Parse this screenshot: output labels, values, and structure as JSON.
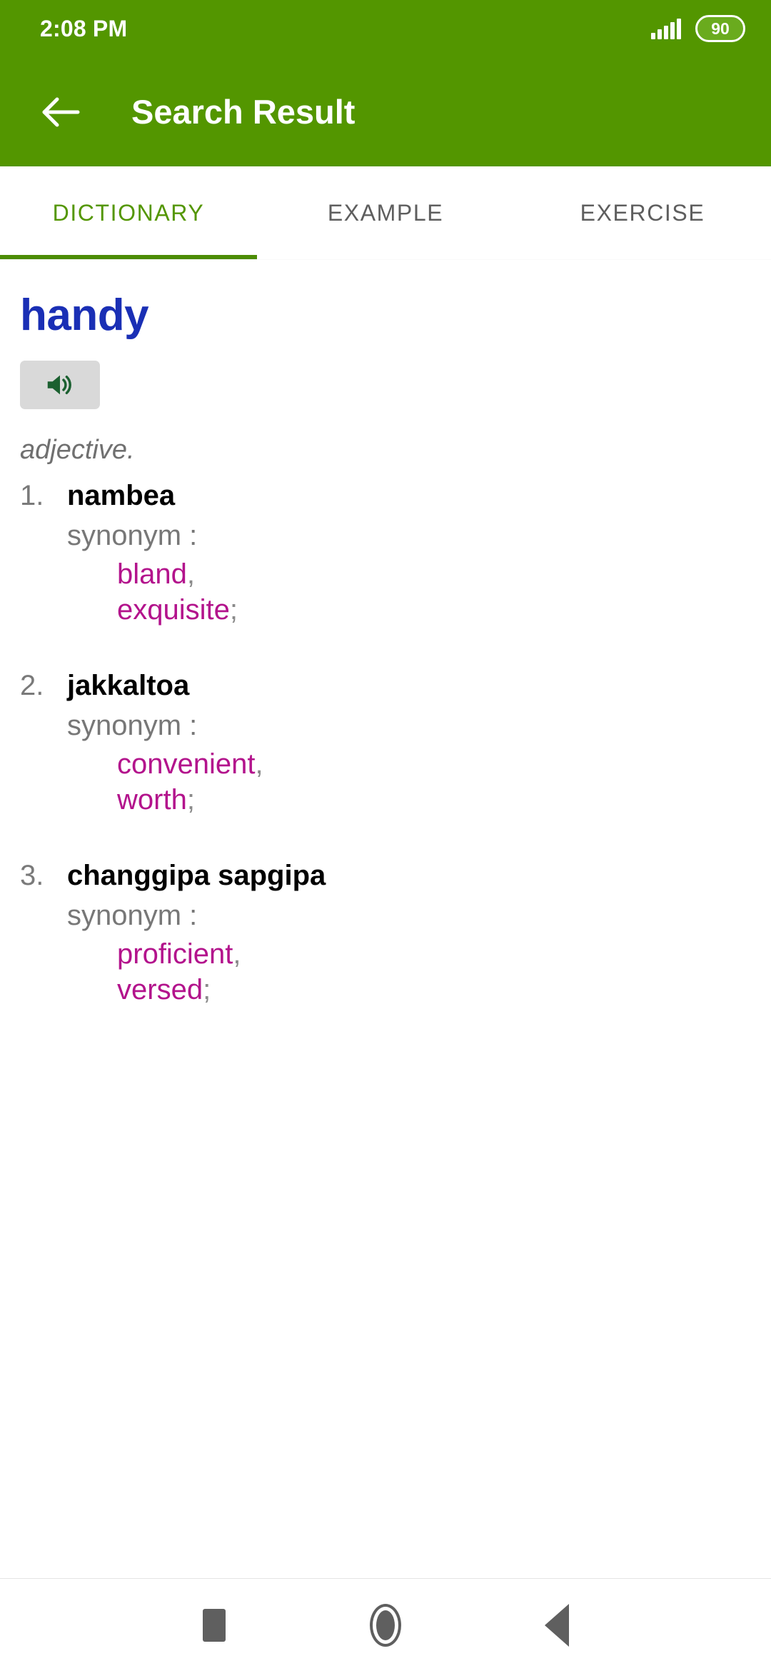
{
  "status_bar": {
    "clock": "2:08 PM",
    "signal_icon": "signal-bars-icon",
    "battery_level": "90"
  },
  "app_bar": {
    "back_icon": "arrow-left-icon",
    "title": "Search Result",
    "background_color": "#539600"
  },
  "tabs": [
    {
      "label": "DICTIONARY",
      "active": true
    },
    {
      "label": "EXAMPLE",
      "active": false
    },
    {
      "label": "EXERCISE",
      "active": false
    }
  ],
  "dictionary": {
    "headword": "handy",
    "headword_color": "#1a2fb5",
    "audio_icon": "speaker-icon",
    "part_of_speech": "adjective.",
    "synonym_label": "synonym :",
    "synonym_color": "#b3138c",
    "entries": [
      {
        "number": "1.",
        "term": "nambea",
        "synonym_label": "synonym :",
        "synonyms": [
          {
            "word": "bland",
            "punct": ","
          },
          {
            "word": "exquisite",
            "punct": ";"
          }
        ]
      },
      {
        "number": "2.",
        "term": "jakkaltoa",
        "synonym_label": "synonym :",
        "synonyms": [
          {
            "word": "convenient",
            "punct": ","
          },
          {
            "word": "worth",
            "punct": ";"
          }
        ]
      },
      {
        "number": "3.",
        "term": "changgipa sapgipa",
        "synonym_label": "synonym :",
        "synonyms": [
          {
            "word": "proficient",
            "punct": ","
          },
          {
            "word": "versed",
            "punct": ";"
          }
        ]
      }
    ]
  },
  "nav_bar": {
    "recents_icon": "square-recents-icon",
    "home_icon": "circle-home-icon",
    "back_icon": "triangle-back-icon"
  }
}
